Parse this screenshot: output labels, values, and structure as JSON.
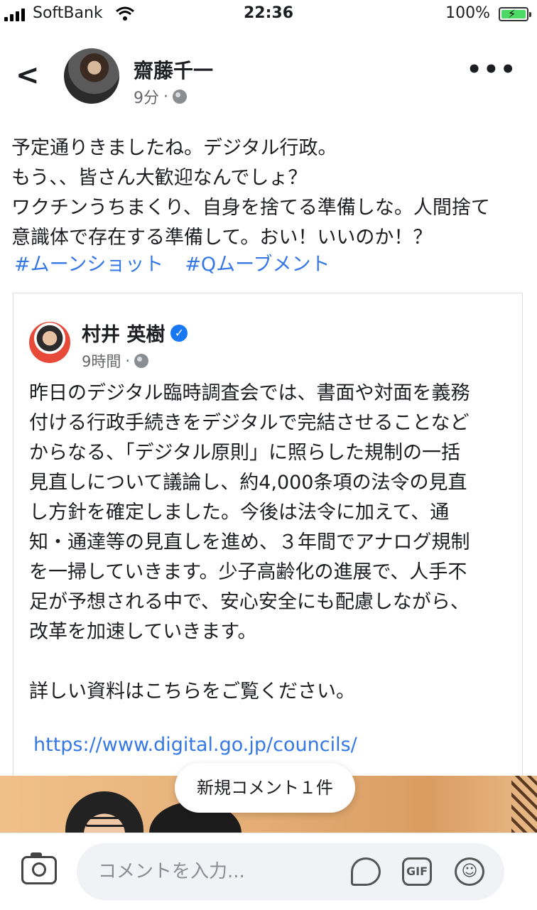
{
  "status_bar": {
    "carrier": "SoftBank",
    "time": "22:36",
    "battery": "100%"
  },
  "post": {
    "author": "齋藤千一",
    "time": "9分",
    "lines": [
      "予定通りきましたね。デジタル行政。",
      "もう、、皆さん大歓迎なんでしょ？",
      "ワクチンうちまくり、自身を捨てる準備しな。人間捨て",
      "意識体で存在する準備して。おい！いいのか！？"
    ],
    "hashtags": [
      "#ムーンショット",
      "#Qムーブメント"
    ]
  },
  "shared": {
    "author": "村井 英樹",
    "time": "9時間",
    "lines": [
      "昨日のデジタル臨時調査会では、書面や対面を義務",
      "付ける行政手続きをデジタルで完結させることなど",
      "からなる、「デジタル原則」に照らした規制の一括",
      "見直しについて議論し、約4,000条項の法令の見直",
      "し方針を確定しました。今後は法令に加えて、通",
      "知・通達等の見直しを進め、３年間でアナログ規制",
      "を一掃していきます。少子高齢化の進展で、人手不",
      "足が予想される中で、安心安全にも配慮しながら、",
      "改革を加速していきます。"
    ],
    "more": "詳しい資料はこちらをご覧ください。",
    "link": "https://www.digital.go.jp/councils/"
  },
  "toast": "新規コメント１件",
  "comment": {
    "placeholder": "コメントを入力...",
    "gif_label": "GIF"
  },
  "icons": [
    "back-icon",
    "more-icon",
    "globe-icon",
    "verified-icon",
    "camera-icon",
    "sticker-icon",
    "gif-icon",
    "emoji-icon"
  ]
}
